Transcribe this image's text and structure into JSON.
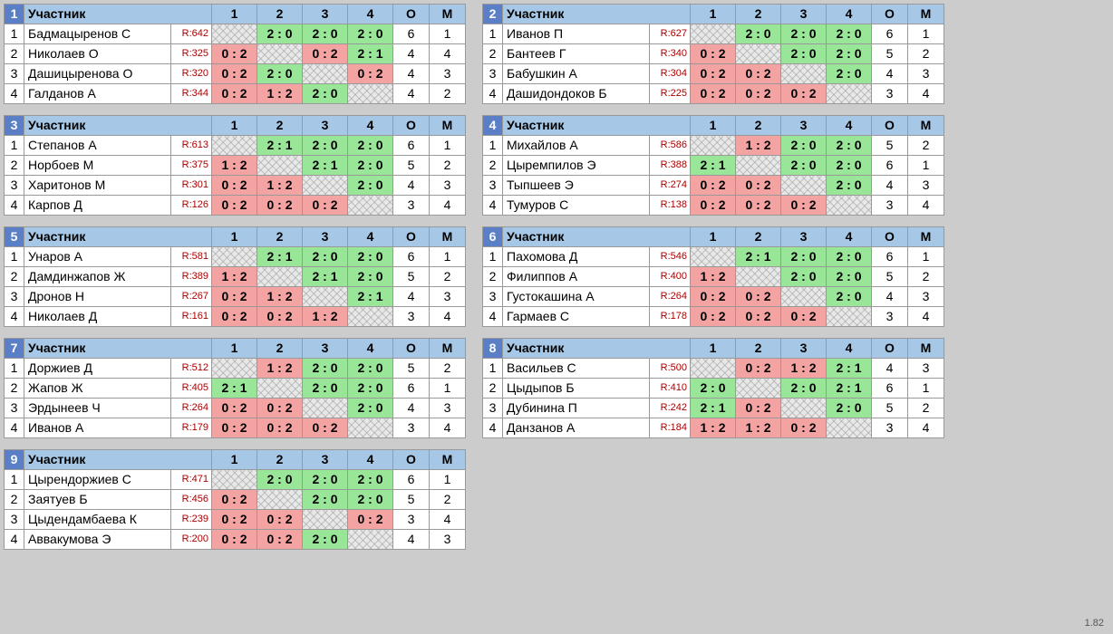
{
  "version": "1.82",
  "header": {
    "participant": "Участник",
    "O": "О",
    "M": "М"
  },
  "groups": [
    {
      "num": 1,
      "players": [
        {
          "name": "Бадмацыренов С",
          "rating": "R:642",
          "scores": [
            "diag",
            "2 : 0",
            "2 : 0",
            "2 : 0"
          ],
          "O": 6,
          "M": 1
        },
        {
          "name": "Николаев О",
          "rating": "R:325",
          "scores": [
            "0 : 2",
            "diag",
            "0 : 2",
            "2 : 1"
          ],
          "O": 4,
          "M": 4
        },
        {
          "name": "Дашицыренова О",
          "rating": "R:320",
          "scores": [
            "0 : 2",
            "2 : 0",
            "diag",
            "0 : 2"
          ],
          "O": 4,
          "M": 3
        },
        {
          "name": "Галданов А",
          "rating": "R:344",
          "scores": [
            "0 : 2",
            "1 : 2",
            "2 : 0",
            "diag"
          ],
          "O": 4,
          "M": 2
        }
      ]
    },
    {
      "num": 2,
      "players": [
        {
          "name": "Иванов П",
          "rating": "R:627",
          "scores": [
            "diag",
            "2 : 0",
            "2 : 0",
            "2 : 0"
          ],
          "O": 6,
          "M": 1
        },
        {
          "name": "Бантеев Г",
          "rating": "R:340",
          "scores": [
            "0 : 2",
            "diag",
            "2 : 0",
            "2 : 0"
          ],
          "O": 5,
          "M": 2
        },
        {
          "name": "Бабушкин А",
          "rating": "R:304",
          "scores": [
            "0 : 2",
            "0 : 2",
            "diag",
            "2 : 0"
          ],
          "O": 4,
          "M": 3
        },
        {
          "name": "Дашидондоков Б",
          "rating": "R:225",
          "scores": [
            "0 : 2",
            "0 : 2",
            "0 : 2",
            "diag"
          ],
          "O": 3,
          "M": 4
        }
      ]
    },
    {
      "num": 3,
      "players": [
        {
          "name": "Степанов А",
          "rating": "R:613",
          "scores": [
            "diag",
            "2 : 1",
            "2 : 0",
            "2 : 0"
          ],
          "O": 6,
          "M": 1
        },
        {
          "name": "Норбоев М",
          "rating": "R:375",
          "scores": [
            "1 : 2",
            "diag",
            "2 : 1",
            "2 : 0"
          ],
          "O": 5,
          "M": 2
        },
        {
          "name": "Харитонов М",
          "rating": "R:301",
          "scores": [
            "0 : 2",
            "1 : 2",
            "diag",
            "2 : 0"
          ],
          "O": 4,
          "M": 3
        },
        {
          "name": "Карпов Д",
          "rating": "R:126",
          "scores": [
            "0 : 2",
            "0 : 2",
            "0 : 2",
            "diag"
          ],
          "O": 3,
          "M": 4
        }
      ]
    },
    {
      "num": 4,
      "players": [
        {
          "name": "Михайлов А",
          "rating": "R:586",
          "scores": [
            "diag",
            "1 : 2",
            "2 : 0",
            "2 : 0"
          ],
          "O": 5,
          "M": 2
        },
        {
          "name": "Цыремпилов Э",
          "rating": "R:388",
          "scores": [
            "2 : 1",
            "diag",
            "2 : 0",
            "2 : 0"
          ],
          "O": 6,
          "M": 1
        },
        {
          "name": "Тыпшеев Э",
          "rating": "R:274",
          "scores": [
            "0 : 2",
            "0 : 2",
            "diag",
            "2 : 0"
          ],
          "O": 4,
          "M": 3
        },
        {
          "name": "Тумуров С",
          "rating": "R:138",
          "scores": [
            "0 : 2",
            "0 : 2",
            "0 : 2",
            "diag"
          ],
          "O": 3,
          "M": 4
        }
      ]
    },
    {
      "num": 5,
      "players": [
        {
          "name": "Унаров А",
          "rating": "R:581",
          "scores": [
            "diag",
            "2 : 1",
            "2 : 0",
            "2 : 0"
          ],
          "O": 6,
          "M": 1
        },
        {
          "name": "Дамдинжапов Ж",
          "rating": "R:389",
          "scores": [
            "1 : 2",
            "diag",
            "2 : 1",
            "2 : 0"
          ],
          "O": 5,
          "M": 2
        },
        {
          "name": "Дронов Н",
          "rating": "R:267",
          "scores": [
            "0 : 2",
            "1 : 2",
            "diag",
            "2 : 1"
          ],
          "O": 4,
          "M": 3
        },
        {
          "name": "Николаев Д",
          "rating": "R:161",
          "scores": [
            "0 : 2",
            "0 : 2",
            "1 : 2",
            "diag"
          ],
          "O": 3,
          "M": 4
        }
      ]
    },
    {
      "num": 6,
      "players": [
        {
          "name": "Пахомова Д",
          "rating": "R:546",
          "scores": [
            "diag",
            "2 : 1",
            "2 : 0",
            "2 : 0"
          ],
          "O": 6,
          "M": 1
        },
        {
          "name": "Филиппов А",
          "rating": "R:400",
          "scores": [
            "1 : 2",
            "diag",
            "2 : 0",
            "2 : 0"
          ],
          "O": 5,
          "M": 2
        },
        {
          "name": "Густокашина А",
          "rating": "R:264",
          "scores": [
            "0 : 2",
            "0 : 2",
            "diag",
            "2 : 0"
          ],
          "O": 4,
          "M": 3
        },
        {
          "name": "Гармаев С",
          "rating": "R:178",
          "scores": [
            "0 : 2",
            "0 : 2",
            "0 : 2",
            "diag"
          ],
          "O": 3,
          "M": 4
        }
      ]
    },
    {
      "num": 7,
      "players": [
        {
          "name": "Доржиев Д",
          "rating": "R:512",
          "scores": [
            "diag",
            "1 : 2",
            "2 : 0",
            "2 : 0"
          ],
          "O": 5,
          "M": 2
        },
        {
          "name": "Жапов Ж",
          "rating": "R:405",
          "scores": [
            "2 : 1",
            "diag",
            "2 : 0",
            "2 : 0"
          ],
          "O": 6,
          "M": 1
        },
        {
          "name": "Эрдынеев Ч",
          "rating": "R:264",
          "scores": [
            "0 : 2",
            "0 : 2",
            "diag",
            "2 : 0"
          ],
          "O": 4,
          "M": 3
        },
        {
          "name": "Иванов А",
          "rating": "R:179",
          "scores": [
            "0 : 2",
            "0 : 2",
            "0 : 2",
            "diag"
          ],
          "O": 3,
          "M": 4
        }
      ]
    },
    {
      "num": 8,
      "players": [
        {
          "name": "Васильев С",
          "rating": "R:500",
          "scores": [
            "diag",
            "0 : 2",
            "1 : 2",
            "2 : 1"
          ],
          "O": 4,
          "M": 3
        },
        {
          "name": "Цыдыпов Б",
          "rating": "R:410",
          "scores": [
            "2 : 0",
            "diag",
            "2 : 0",
            "2 : 1"
          ],
          "O": 6,
          "M": 1
        },
        {
          "name": "Дубинина П",
          "rating": "R:242",
          "scores": [
            "2 : 1",
            "0 : 2",
            "diag",
            "2 : 0"
          ],
          "O": 5,
          "M": 2
        },
        {
          "name": "Данзанов А",
          "rating": "R:184",
          "scores": [
            "1 : 2",
            "1 : 2",
            "0 : 2",
            "diag"
          ],
          "O": 3,
          "M": 4
        }
      ]
    },
    {
      "num": 9,
      "players": [
        {
          "name": "Цырендоржиев С",
          "rating": "R:471",
          "scores": [
            "diag",
            "2 : 0",
            "2 : 0",
            "2 : 0"
          ],
          "O": 6,
          "M": 1
        },
        {
          "name": "Заятуев Б",
          "rating": "R:456",
          "scores": [
            "0 : 2",
            "diag",
            "2 : 0",
            "2 : 0"
          ],
          "O": 5,
          "M": 2
        },
        {
          "name": "Цыдендамбаева К",
          "rating": "R:239",
          "scores": [
            "0 : 2",
            "0 : 2",
            "diag",
            "0 : 2"
          ],
          "O": 3,
          "M": 4
        },
        {
          "name": "Аввакумова Э",
          "rating": "R:200",
          "scores": [
            "0 : 2",
            "0 : 2",
            "2 : 0",
            "diag"
          ],
          "O": 4,
          "M": 3
        }
      ]
    }
  ]
}
